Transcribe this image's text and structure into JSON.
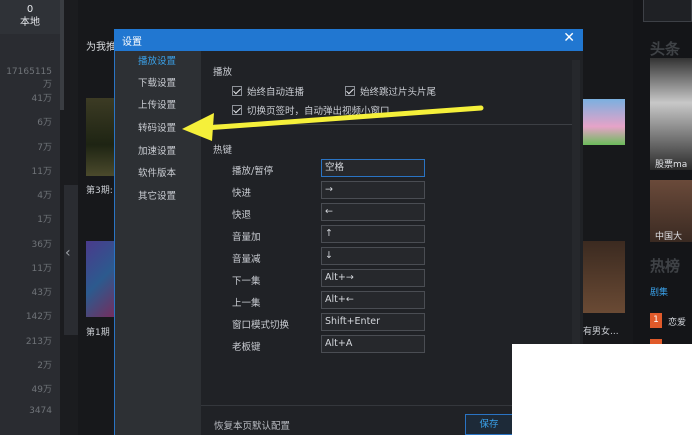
{
  "left_panel": {
    "top_count": "0",
    "top_label": "本地",
    "numbers": [
      "17165115万",
      "41万",
      "6万",
      "7万",
      "11万",
      "4万",
      "1万",
      "36万",
      "11万",
      "43万",
      "142万",
      "213万",
      "2万",
      "49万",
      "3474"
    ]
  },
  "background": {
    "section_title": "为我推",
    "caption_1": "第3期:",
    "caption_2": "第1期",
    "caption_right": "有男女..."
  },
  "right_panel": {
    "heading": "头条",
    "caption_1": "股票ma",
    "caption_2": "中国大",
    "hot_heading": "热榜",
    "tab": "剧集",
    "rank_1": "1",
    "item_1": "恋爱"
  },
  "dialog": {
    "title": "设置",
    "close_icon": "✕",
    "nav": [
      {
        "label": "播放设置",
        "active": true
      },
      {
        "label": "下载设置",
        "active": false
      },
      {
        "label": "上传设置",
        "active": false
      },
      {
        "label": "转码设置",
        "active": false
      },
      {
        "label": "加速设置",
        "active": false
      },
      {
        "label": "软件版本",
        "active": false
      },
      {
        "label": "其它设置",
        "active": false
      }
    ],
    "play_section": {
      "title": "播放",
      "opt_autoplay": "始终自动连播",
      "opt_skip": "始终跳过片头片尾",
      "opt_popup": "切换页签时，自动弹出视频小窗口"
    },
    "hotkey_section": {
      "title": "热键",
      "rows": [
        {
          "label": "播放/暂停",
          "value": "空格"
        },
        {
          "label": "快进",
          "value": "→"
        },
        {
          "label": "快退",
          "value": "←"
        },
        {
          "label": "音量加",
          "value": "↑"
        },
        {
          "label": "音量减",
          "value": "↓"
        },
        {
          "label": "下一集",
          "value": "Alt+→"
        },
        {
          "label": "上一集",
          "value": "Alt+←"
        },
        {
          "label": "窗口模式切换",
          "value": "Shift+Enter"
        },
        {
          "label": "老板键",
          "value": "Alt+A"
        }
      ]
    },
    "footer": {
      "restore_label": "恢复本页默认配置",
      "save_label": "保存"
    }
  },
  "annotation": {
    "arrow_color": "#f5f03a"
  }
}
